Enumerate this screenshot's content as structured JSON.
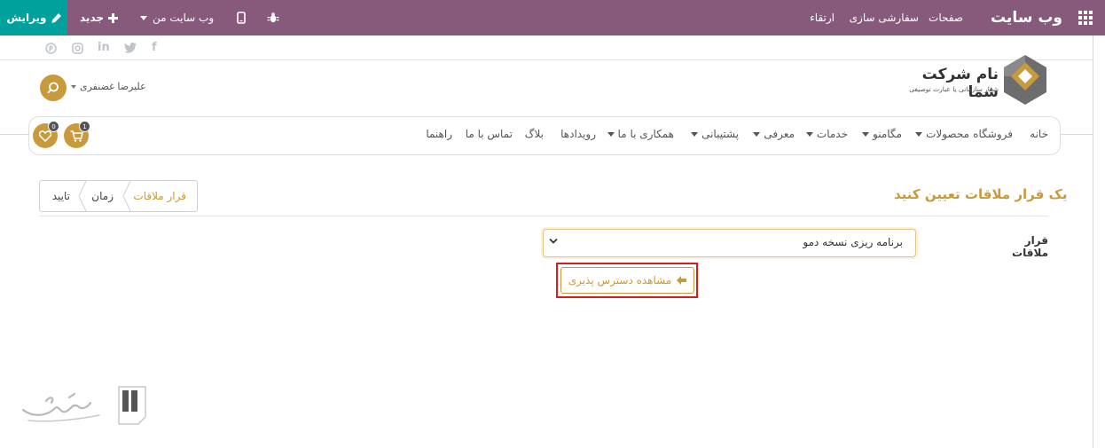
{
  "topbar": {
    "app_title": "وب سایت",
    "menu": [
      "صفحات",
      "سفارشی سازی",
      "ارتقاء"
    ],
    "site_menu_label": "وب سایت من",
    "new_label": "جدید",
    "edit_label": "ویرایش"
  },
  "social": [
    "facebook-icon",
    "twitter-icon",
    "linkedin-icon",
    "instagram-icon",
    "pinterest-icon"
  ],
  "logo": {
    "title": "نام شرکت شما",
    "slogan": "شعار سازمانی یا عبارت توصیفی"
  },
  "user": {
    "name": "علیرضا غضنفری"
  },
  "nav": {
    "items": [
      {
        "label": "خانه",
        "dropdown": false
      },
      {
        "label": "فروشگاه",
        "dropdown": false
      },
      {
        "label": "محصولات",
        "dropdown": true
      },
      {
        "label": "مگامنو",
        "dropdown": true
      },
      {
        "label": "خدمات",
        "dropdown": true
      },
      {
        "label": "معرفی",
        "dropdown": true
      },
      {
        "label": "پشتیبانی",
        "dropdown": true
      },
      {
        "label": "همکاری با ما",
        "dropdown": true
      },
      {
        "label": "رویدادها",
        "dropdown": false
      },
      {
        "label": "بلاگ",
        "dropdown": false
      },
      {
        "label": "تماس با ما",
        "dropdown": false
      },
      {
        "label": "راهنما",
        "dropdown": false
      }
    ],
    "cart_count": "1",
    "wishlist_count": "0"
  },
  "appointment": {
    "title": "یک قرار ملاقات تعیین کنید",
    "steps": [
      "قرار ملاقات",
      "زمان",
      "تایید"
    ],
    "active_step": 0,
    "field_label": "قرار ملاقات",
    "select_value": "برنامه ریزی نسخه دمو",
    "availability_button": "مشاهده دسترس پذیری"
  },
  "colors": {
    "admin_bar": "#875a7b",
    "edit_button": "#00a09d",
    "accent": "#c99a3b",
    "highlight": "#d51c20"
  }
}
